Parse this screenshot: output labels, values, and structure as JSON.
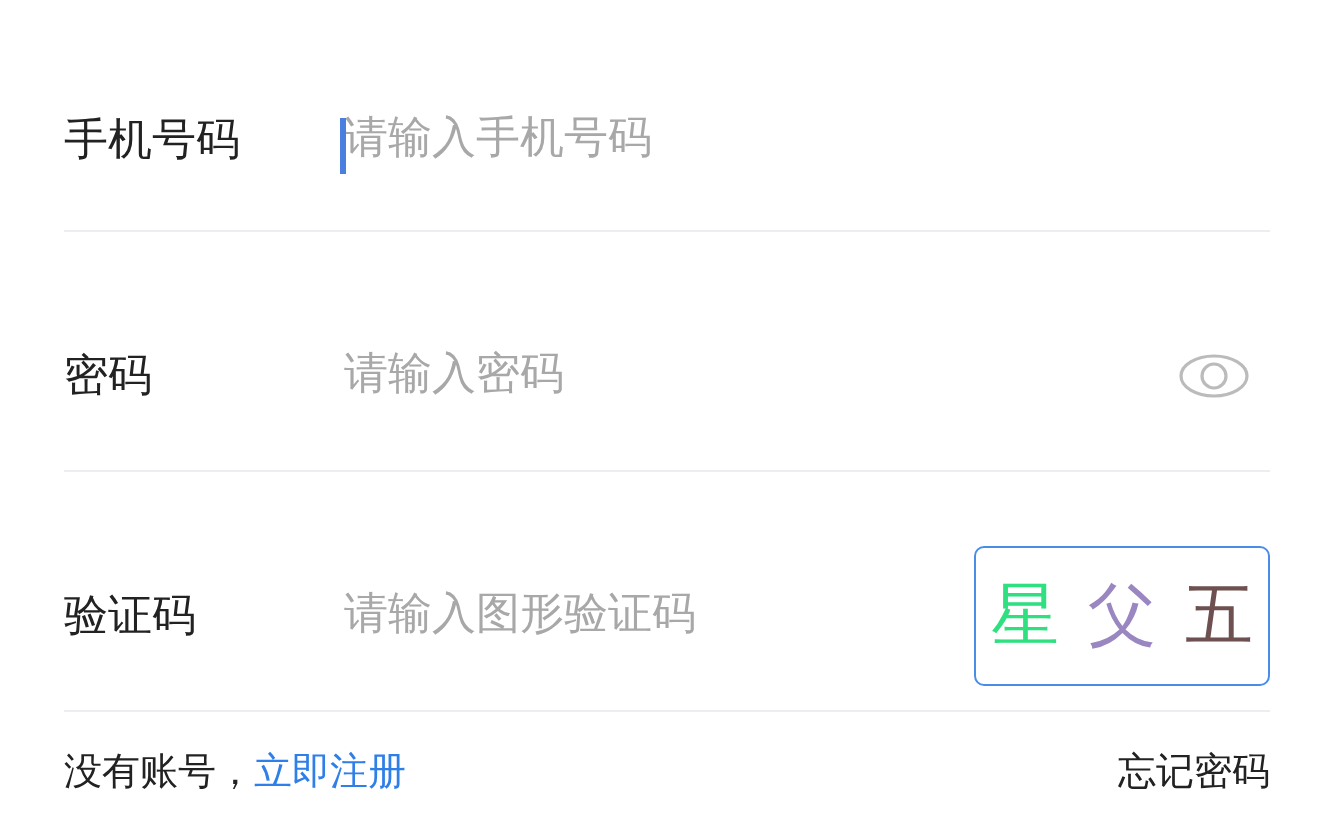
{
  "fields": [
    {
      "kind": "text",
      "label": "手机号码",
      "placeholder": "请输入手机号码",
      "focused": true
    },
    {
      "kind": "password",
      "label": "密码",
      "placeholder": "请输入密码",
      "focused": false
    },
    {
      "kind": "captcha",
      "label": "验证码",
      "placeholder": "请输入图形验证码",
      "focused": false,
      "captcha": [
        {
          "char": "星",
          "color": "#2ee07f"
        },
        {
          "char": "父",
          "color": "#9a86c0"
        },
        {
          "char": "五",
          "color": "#6e5050"
        }
      ]
    }
  ],
  "footer": {
    "prompt": "没有账号，",
    "register_link": "立即注册",
    "forgot_link": "忘记密码"
  }
}
